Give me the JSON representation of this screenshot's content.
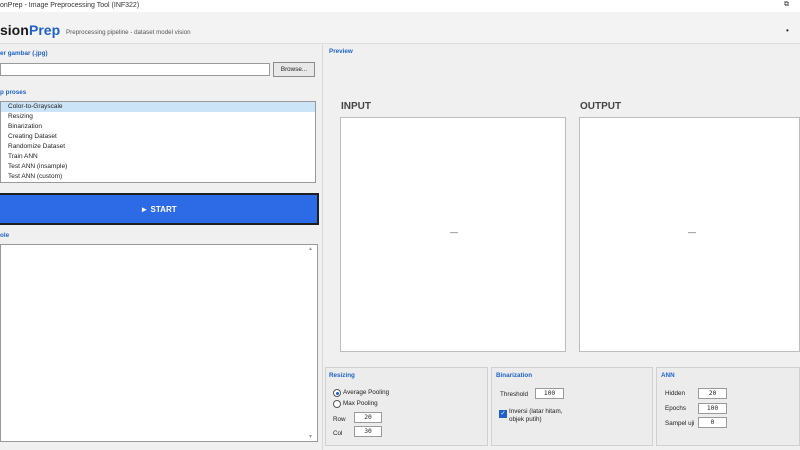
{
  "window": {
    "title": "onPrep - Image Preprocessing Tool (INF322)",
    "restore_glyph": "⧉"
  },
  "header": {
    "logo_part1": "sion",
    "logo_part2": "Prep",
    "subtitle": "Preprocessing pipeline - dataset model vision",
    "menu_glyph": "•"
  },
  "file_section": {
    "label": "er gambar (.jpg)",
    "path_value": "",
    "browse_label": "Browse..."
  },
  "steps_section": {
    "label": "p proses",
    "items": [
      "Color-to-Grayscale",
      "Resizing",
      "Binarization",
      "Creating Dataset",
      "Randomize Dataset",
      "Train ANN",
      "Test ANN (insample)",
      "Test ANN (custom)"
    ],
    "selected_index": 0
  },
  "start_button": {
    "label": "►  START"
  },
  "console_section": {
    "label": "ole",
    "content": ""
  },
  "preview": {
    "label": "Preview",
    "input_title": "INPUT",
    "output_title": "OUTPUT",
    "input_placeholder": "—",
    "output_placeholder": "—"
  },
  "resizing": {
    "label": "Resizing",
    "option_avg": "Average Pooling",
    "option_max": "Max Pooling",
    "selected": "Average Pooling",
    "row_label": "Row",
    "row_value": "20",
    "col_label": "Col",
    "col_value": "30"
  },
  "binarization": {
    "label": "Binarization",
    "threshold_label": "Threshold",
    "threshold_value": "100",
    "invert_line1": "Inversi (latar hitam,",
    "invert_line2": "objek putih)",
    "invert_checked": true,
    "check_glyph": "✓"
  },
  "ann": {
    "label": "ANN",
    "hidden_label": "Hidden",
    "hidden_value": "20",
    "epochs_label": "Epochs",
    "epochs_value": "100",
    "samples_label": "Sampel uji",
    "samples_value": "0"
  },
  "colors": {
    "accent": "#1e62c9",
    "start_button": "#2d6ae5",
    "list_selection": "#cce4f7"
  }
}
